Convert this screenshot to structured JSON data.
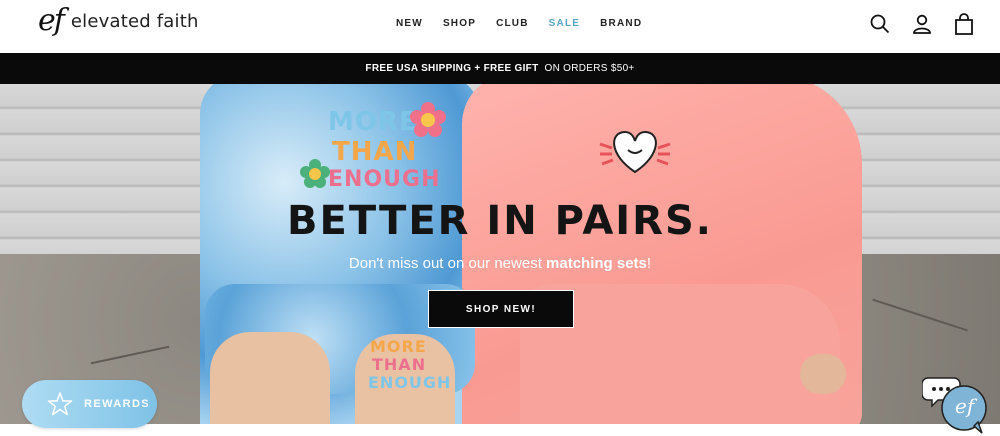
{
  "brand": {
    "mark": "ef",
    "name": "elevated faith"
  },
  "nav": {
    "items": [
      {
        "label": "NEW"
      },
      {
        "label": "SHOP"
      },
      {
        "label": "CLUB"
      },
      {
        "label": "SALE"
      },
      {
        "label": "BRAND"
      }
    ]
  },
  "header_icons": [
    "search-icon",
    "account-icon",
    "cart-icon"
  ],
  "announcement": {
    "strong": "FREE USA SHIPPING + FREE GIFT",
    "light": "ON ORDERS $50+"
  },
  "hero": {
    "title": "BETTER IN PAIRS.",
    "subtitle_pre": "Don't miss out on our newest ",
    "subtitle_bold": "matching sets",
    "subtitle_post": "!",
    "cta": "SHOP NEW!",
    "shirt_graphic_lines": [
      "MORE",
      "THAN",
      "ENOUGH"
    ],
    "shorts_graphic_lines": [
      "MORE",
      "THAN",
      "ENOUGH"
    ]
  },
  "rewards": {
    "label": "REWARDS",
    "icon": "star-icon"
  },
  "chat": {
    "icon": "chat-bubbles-icon",
    "avatar_mark": "ef"
  },
  "colors": {
    "sale": "#5ba4c4",
    "announce_bg": "#0a0a0a",
    "rewards": "#7fc2e6",
    "tie_dye_blue": "#4f99d4",
    "pink": "#f99a92"
  }
}
